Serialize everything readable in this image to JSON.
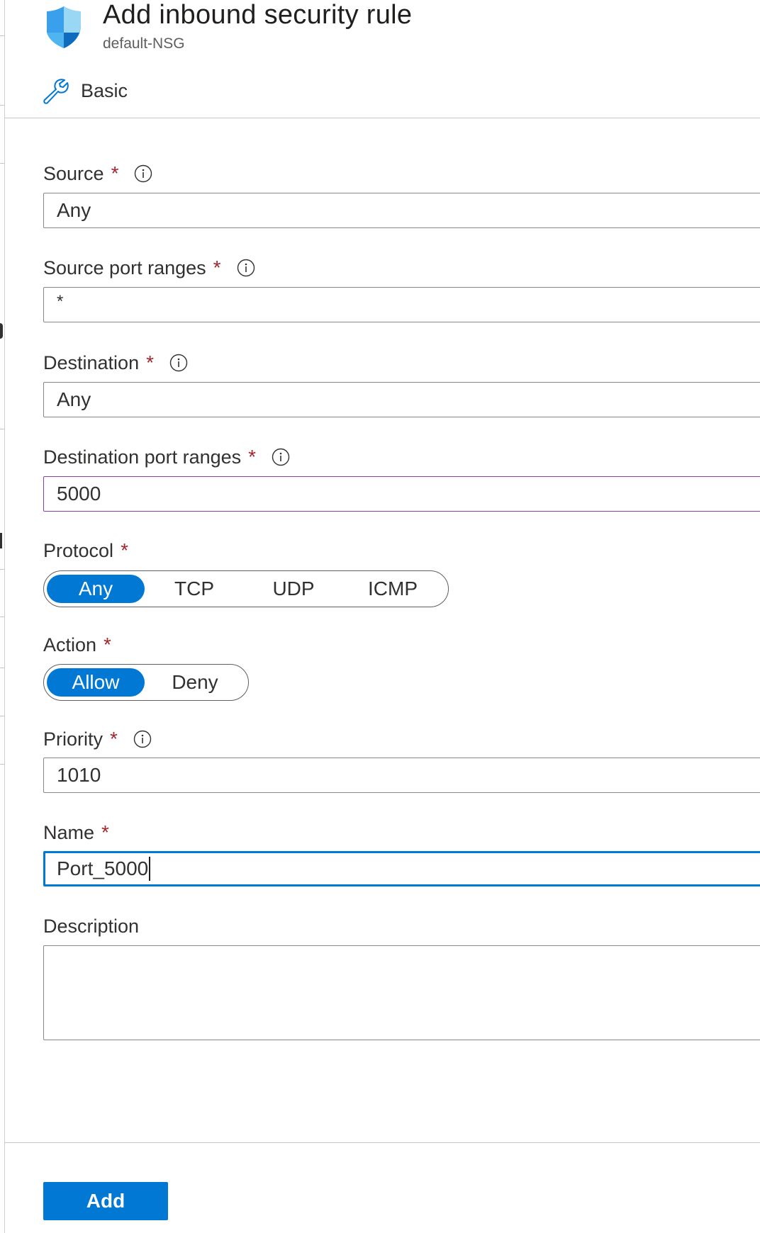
{
  "header": {
    "title": "Add inbound security rule",
    "subtitle": "default-NSG",
    "icon": "shield-icon"
  },
  "tab": {
    "label": "Basic",
    "icon": "wrench-icon"
  },
  "required_marker": "*",
  "form": {
    "source": {
      "label": "Source",
      "value": "Any"
    },
    "source_port_ranges": {
      "label": "Source port ranges",
      "value": "*"
    },
    "destination": {
      "label": "Destination",
      "value": "Any"
    },
    "destination_port_ranges": {
      "label": "Destination port ranges",
      "value": "5000"
    },
    "protocol": {
      "label": "Protocol",
      "options": [
        "Any",
        "TCP",
        "UDP",
        "ICMP"
      ],
      "selected": "Any"
    },
    "action": {
      "label": "Action",
      "options": [
        "Allow",
        "Deny"
      ],
      "selected": "Allow"
    },
    "priority": {
      "label": "Priority",
      "value": "1010"
    },
    "name": {
      "label": "Name",
      "value": "Port_5000"
    },
    "description": {
      "label": "Description",
      "value": ""
    }
  },
  "footer": {
    "add_label": "Add"
  },
  "colors": {
    "accent": "#0078d4",
    "required": "#a4262c",
    "validation_border": "#8b3fa8"
  }
}
